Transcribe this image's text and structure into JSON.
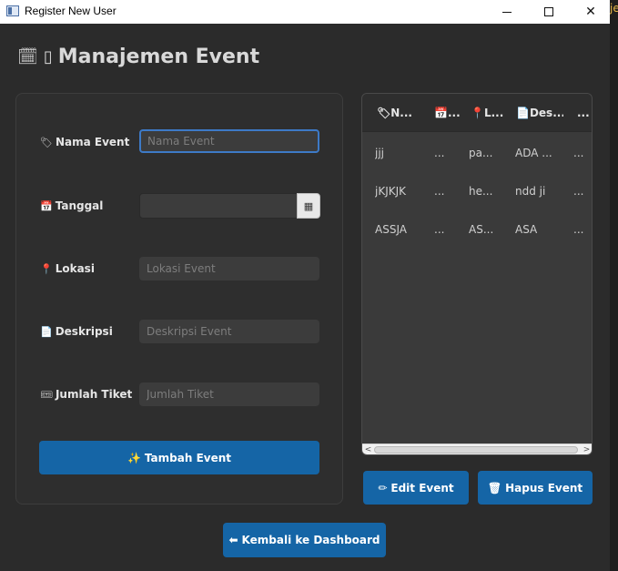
{
  "window": {
    "title": "Register New User",
    "minimize_glyph": "—",
    "maximize_glyph": "☐",
    "close_glyph": "✕"
  },
  "edge_text": "je",
  "page": {
    "title_icon": "🗓",
    "title_glyph": "▯",
    "title": "Manajemen Event"
  },
  "form": {
    "name": {
      "icon": "🏷",
      "label": "Nama Event",
      "placeholder": "Nama Event",
      "value": ""
    },
    "date": {
      "icon": "📅",
      "label": "Tanggal",
      "value": "",
      "picker_icon": "▦"
    },
    "location": {
      "icon": "📍",
      "label": "Lokasi",
      "placeholder": "Lokasi Event",
      "value": ""
    },
    "description": {
      "icon": "📄",
      "label": "Deskripsi",
      "placeholder": "Deskripsi Event",
      "value": ""
    },
    "tickets": {
      "icon": "🎟",
      "label": "Jumlah Tiket",
      "placeholder": "Jumlah Tiket",
      "value": ""
    },
    "submit": {
      "icon": "✨",
      "label": "Tambah Event"
    }
  },
  "table": {
    "columns": [
      {
        "icon": "🏷",
        "label": "N..."
      },
      {
        "icon": "📅",
        "label": "..."
      },
      {
        "icon": "📍",
        "label": "L..."
      },
      {
        "icon": "📄",
        "label": "Des..."
      },
      {
        "icon": "",
        "label": "..."
      }
    ],
    "rows": [
      [
        "jjj",
        "...",
        "pa...",
        "ADA ...",
        "..."
      ],
      [
        "jKJKJK",
        "...",
        "he...",
        "ndd ji",
        "..."
      ],
      [
        "ASSJA",
        "...",
        "AS...",
        "ASA",
        "..."
      ]
    ],
    "scroll_left": "<",
    "scroll_right": ">"
  },
  "actions": {
    "edit": {
      "icon": "✏",
      "label": "Edit Event"
    },
    "delete": {
      "icon": "🗑",
      "label": "Hapus Event"
    },
    "back": {
      "icon": "⬅",
      "label": "Kembali ke Dashboard"
    }
  },
  "colors": {
    "background": "#2b2b2b",
    "panel": "#2e2e2e",
    "input": "#3c3c3c",
    "accent": "#1565a6",
    "focus_border": "#3d7ac7",
    "text": "#e6e6e6"
  }
}
